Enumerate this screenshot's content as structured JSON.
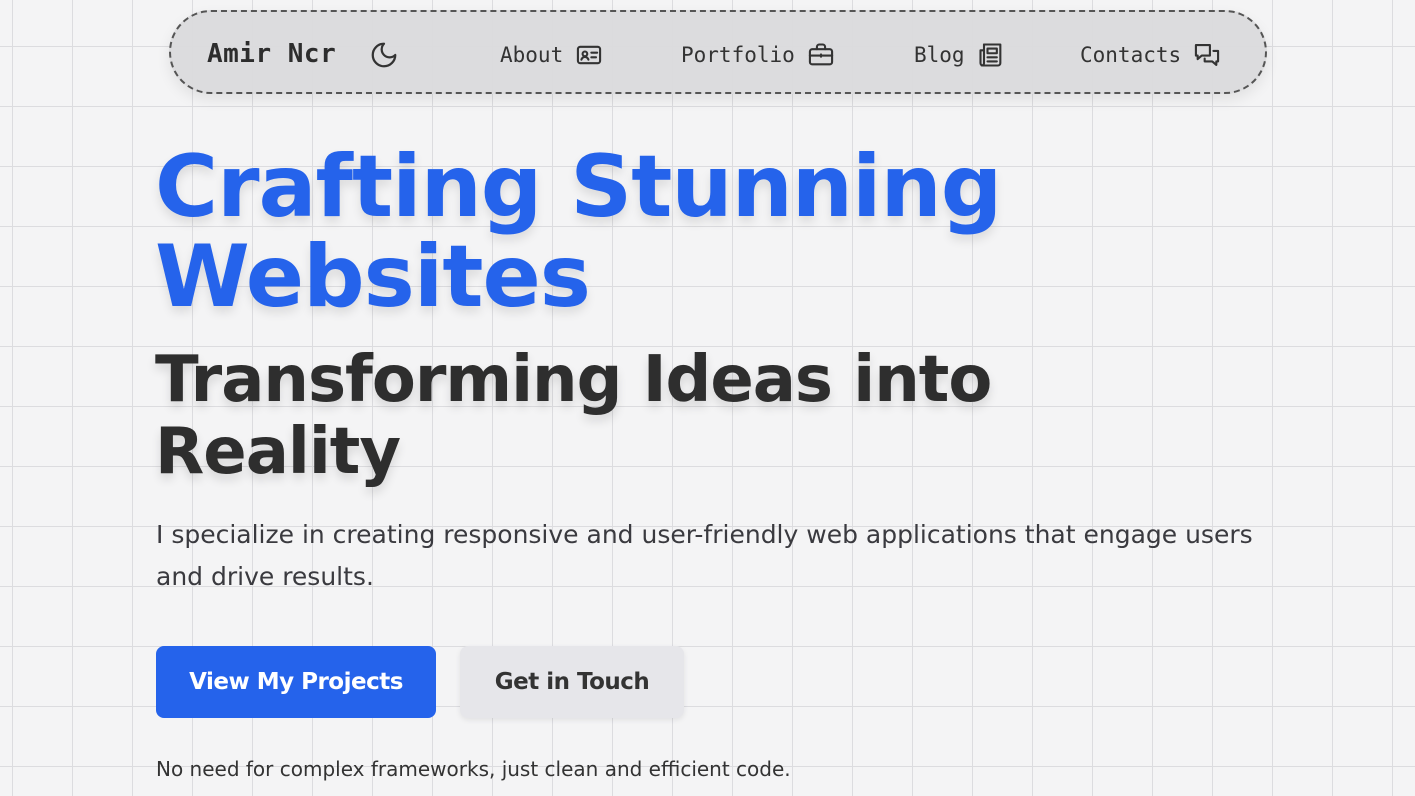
{
  "nav": {
    "brand": "Amir Ncr",
    "theme_icon": "moon-icon",
    "items": [
      {
        "label": "About",
        "icon": "id-card-icon"
      },
      {
        "label": "Portfolio",
        "icon": "briefcase-icon"
      },
      {
        "label": "Blog",
        "icon": "newspaper-icon"
      },
      {
        "label": "Contacts",
        "icon": "chat-bubbles-icon"
      }
    ]
  },
  "hero": {
    "title": "Crafting Stunning Websites",
    "subtitle": "Transforming Ideas into Reality",
    "description": "I specialize in creating responsive and user-friendly web applications that engage users and drive results.",
    "primary_button": "View My Projects",
    "secondary_button": "Get in Touch",
    "note": "No need for complex frameworks, just clean and efficient code."
  },
  "colors": {
    "accent": "#2563eb",
    "background": "#f4f4f5",
    "navbar_bg": "#dadadc",
    "text_dark": "#2e2e2e",
    "secondary_button_bg": "#e6e6ea"
  }
}
